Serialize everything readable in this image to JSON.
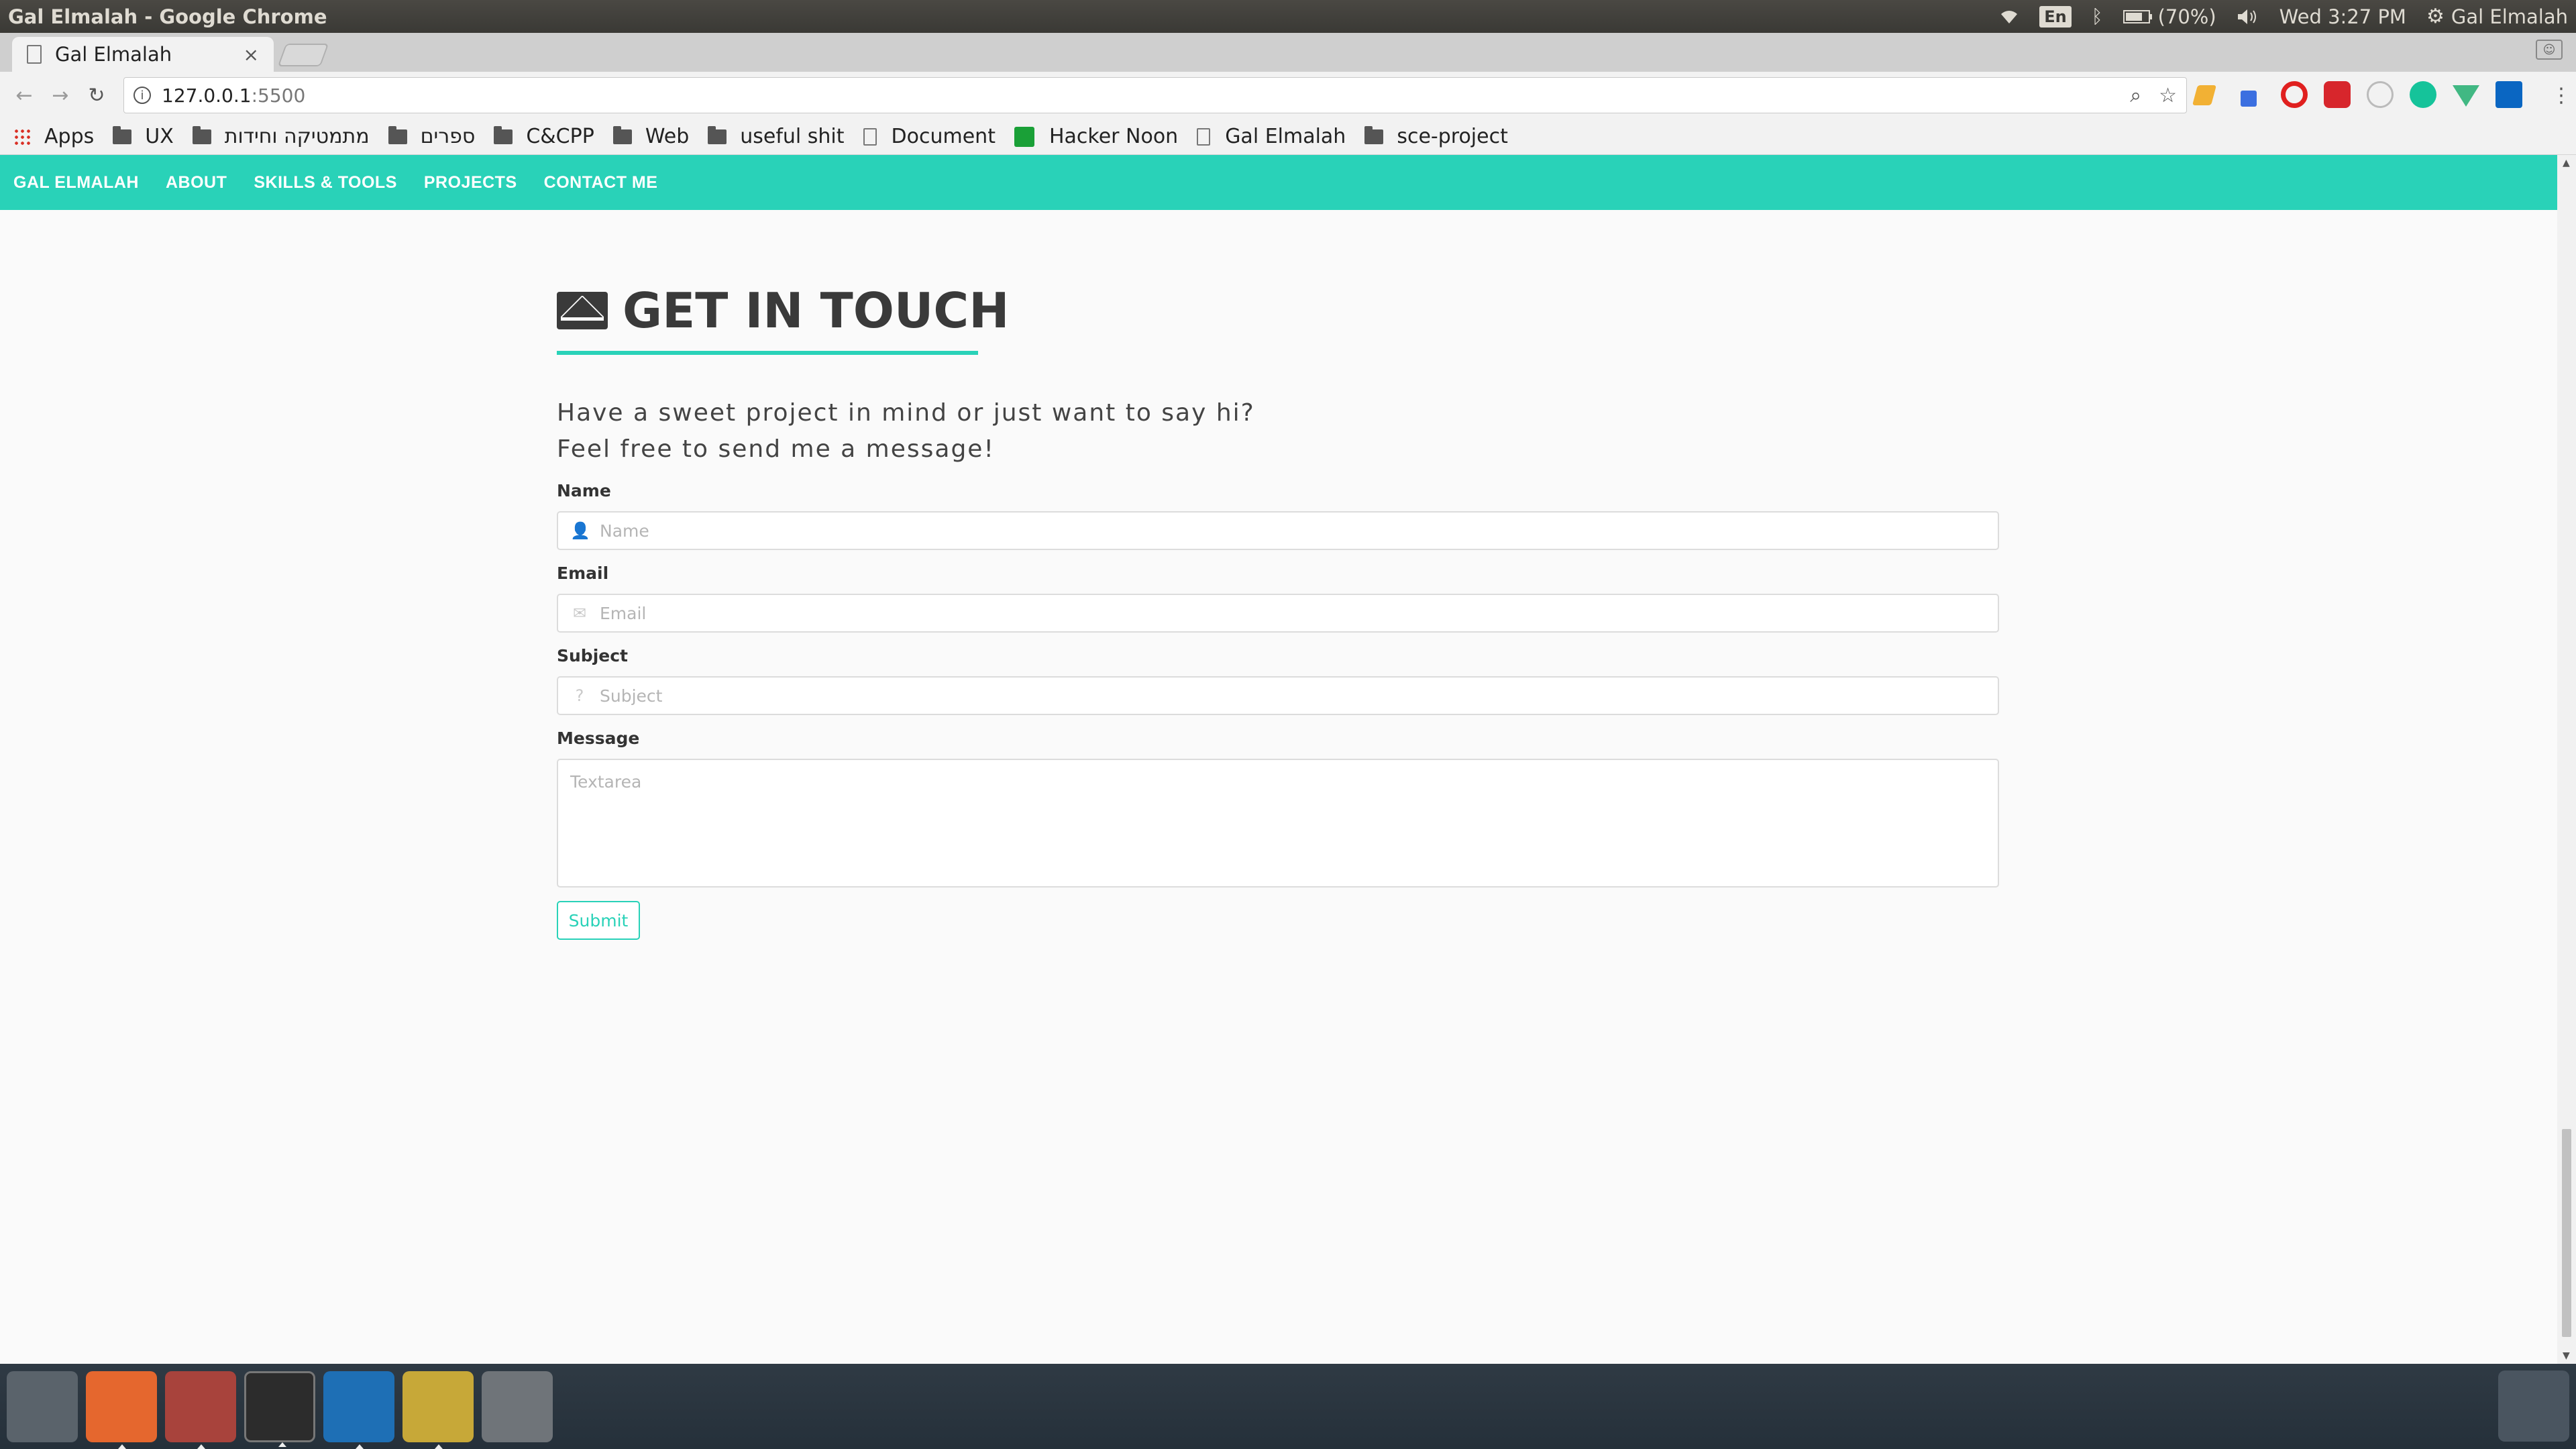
{
  "os": {
    "window_title": "Gal Elmalah - Google Chrome",
    "keyboard_layout": "En",
    "battery": "(70%)",
    "clock": "Wed  3:27 PM",
    "user": "Gal Elmalah"
  },
  "browser": {
    "tab_title": "Gal Elmalah",
    "tab_close": "×",
    "url_host": "127.0.0.1",
    "url_port": ":5500",
    "bookmarks": [
      {
        "label": "Apps",
        "icon": "apps-grid-icon"
      },
      {
        "label": "UX",
        "icon": "folder-icon"
      },
      {
        "label": "מתמטיקה וחידות",
        "icon": "folder-icon"
      },
      {
        "label": "ספרים",
        "icon": "folder-icon"
      },
      {
        "label": "C&CPP",
        "icon": "folder-icon"
      },
      {
        "label": "Web",
        "icon": "folder-icon"
      },
      {
        "label": "useful shit",
        "icon": "folder-icon"
      },
      {
        "label": "Document",
        "icon": "page-icon"
      },
      {
        "label": "Hacker Noon",
        "icon": "hackernoon-icon"
      },
      {
        "label": "Gal Elmalah",
        "icon": "page-icon"
      },
      {
        "label": "sce-project",
        "icon": "folder-icon"
      }
    ]
  },
  "site": {
    "nav": [
      "GAL ELMALAH",
      "ABOUT",
      "SKILLS & TOOLS",
      "PROJECTS",
      "CONTACT ME"
    ],
    "accent_color": "#29d2b8",
    "heading": "GET IN TOUCH",
    "intro_line1": "Have a sweet project in mind or just want to say hi?",
    "intro_line2": "Feel free to send me a message!",
    "form": {
      "name_label": "Name",
      "name_placeholder": "Name",
      "email_label": "Email",
      "email_placeholder": "Email",
      "subject_label": "Subject",
      "subject_placeholder": "Subject",
      "message_label": "Message",
      "message_placeholder": "Textarea",
      "submit_label": "Submit"
    }
  }
}
